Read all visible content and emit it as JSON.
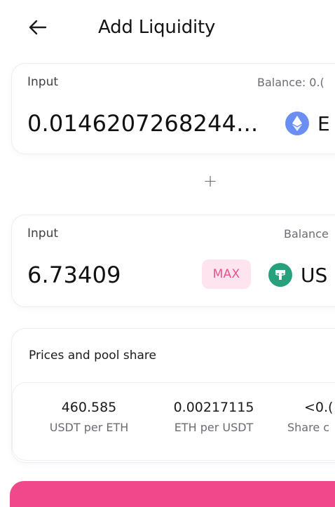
{
  "header": {
    "title": "Add Liquidity"
  },
  "input_a": {
    "label": "Input",
    "balance_label": "Balance: 0.(",
    "amount": "0.0146207268244...",
    "token_symbol": "E",
    "token_icon": "ethereum-icon"
  },
  "plus_sign": "+",
  "input_b": {
    "label": "Input",
    "balance_label": "Balance",
    "amount": "6.73409",
    "max_label": "MAX",
    "token_symbol": "US",
    "token_icon": "tether-icon"
  },
  "prices": {
    "title": "Prices and pool share",
    "stats": [
      {
        "value": "460.585",
        "label": "USDT per ETH"
      },
      {
        "value": "0.00217115",
        "label": "ETH per USDT"
      },
      {
        "value": "<0.(",
        "label": "Share c"
      }
    ]
  },
  "colors": {
    "accent_pink": "#f0488b",
    "max_bg": "#fde4ee",
    "max_text": "#e8538c",
    "eth_blue": "#6b8ef2",
    "usdt_green": "#26a17b"
  }
}
